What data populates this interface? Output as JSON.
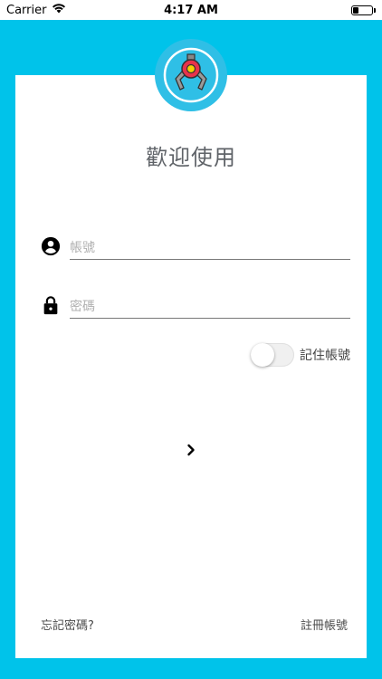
{
  "status_bar": {
    "carrier": "Carrier",
    "time": "4:17 AM",
    "battery_level": 0.25
  },
  "colors": {
    "background": "#00c3ea",
    "logo_circle": "#2fbfe6",
    "claw_red": "#e8334a",
    "claw_yellow": "#f5d000"
  },
  "header": {
    "title": "歡迎使用",
    "logo_icon": "claw-machine-icon"
  },
  "form": {
    "username": {
      "placeholder": "帳號",
      "value": "",
      "icon": "account-circle-icon"
    },
    "password": {
      "placeholder": "密碼",
      "value": "",
      "icon": "lock-icon"
    },
    "remember": {
      "label": "記住帳號",
      "checked": false
    }
  },
  "actions": {
    "next_icon": "chevron-right-icon"
  },
  "footer": {
    "forgot_password": "忘記密碼?",
    "register": "註冊帳號"
  }
}
